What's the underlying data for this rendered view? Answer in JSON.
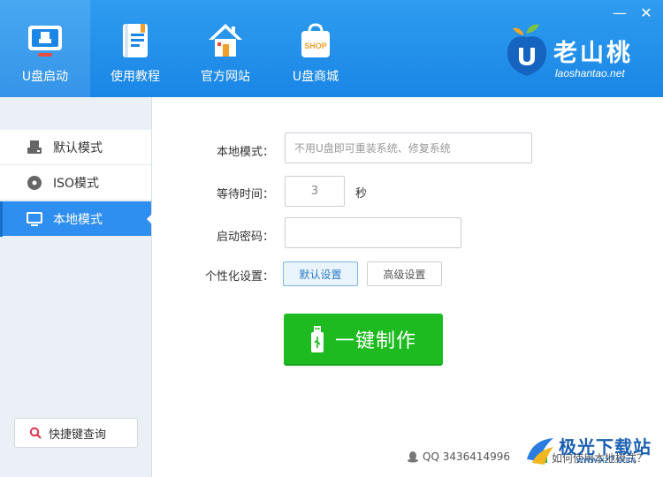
{
  "nav": [
    {
      "label": "U盘启动",
      "icon": "usb-boot-icon",
      "active": true
    },
    {
      "label": "使用教程",
      "icon": "book-icon",
      "active": false
    },
    {
      "label": "官方网站",
      "icon": "home-icon",
      "active": false
    },
    {
      "label": "U盘商城",
      "icon": "shop-bag-icon",
      "active": false
    }
  ],
  "shop_bag_text": "SHOP",
  "window": {
    "minimize": "—",
    "close": "✕"
  },
  "brand": {
    "name_cn": "老山桃",
    "name_en": "laoshantao.net"
  },
  "sidebar": {
    "items": [
      {
        "label": "默认模式",
        "icon": "drive-icon",
        "active": false
      },
      {
        "label": "ISO模式",
        "icon": "disc-icon",
        "active": false
      },
      {
        "label": "本地模式",
        "icon": "monitor-icon",
        "active": true
      }
    ],
    "shortcut_label": "快捷键查询"
  },
  "form": {
    "local_mode_label": "本地模式：",
    "local_mode_placeholder": "不用U盘即可重装系统、修复系统",
    "wait_label": "等待时间：",
    "wait_value": "3",
    "wait_unit": "秒",
    "password_label": "启动密码：",
    "password_value": "",
    "personal_label": "个性化设置：",
    "default_settings": "默认设置",
    "advanced_settings": "高级设置"
  },
  "make_button": "一键制作",
  "footer": {
    "qq": "QQ 3436414996",
    "help": "如何使用本地模式？"
  },
  "watermark": {
    "cn": "极光下载站",
    "en": "www.xz7.com"
  },
  "colors": {
    "header": "#1a86e6",
    "accent": "#2f8ff0",
    "make_button": "#1dbb1f"
  }
}
